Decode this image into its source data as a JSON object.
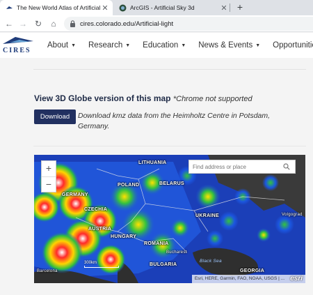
{
  "browser": {
    "tabs": [
      {
        "title": "The New World Atlas of Artificial",
        "active": true
      },
      {
        "title": "ArcGIS - Artificial Sky 3d",
        "active": false
      }
    ],
    "new_tab_label": "+",
    "url": "cires.colorado.edu/Artificial-light"
  },
  "site": {
    "logo_text": "CIRES",
    "nav": [
      {
        "label": "About"
      },
      {
        "label": "Research"
      },
      {
        "label": "Education"
      },
      {
        "label": "News & Events"
      },
      {
        "label": "Opportunities"
      }
    ]
  },
  "main": {
    "heading": "View 3D Globe version of this map",
    "heading_note": "*Chrome not supported",
    "download_button": "Download",
    "download_text": "Download kmz data from the Heimholtz Centre in Potsdam, Germany."
  },
  "map": {
    "zoom_in": "+",
    "zoom_out": "−",
    "search_placeholder": "Find address or place",
    "labels": {
      "lithuania": "LITHUANIA",
      "poland": "POLAND",
      "belarus": "BELARUS",
      "germany": "GERMANY",
      "czechia": "CZECHIA",
      "ukraine": "UKRAINE",
      "austria": "AUSTRIA",
      "hungary": "HUNGARY",
      "romania": "ROMANIA",
      "bulgaria": "BULGARIA",
      "georgia": "GEORGIA",
      "bucharest": "Bucharest",
      "black_sea": "Black Sea",
      "volgograd": "Volgograd",
      "barcelona": "Barcelona"
    },
    "scale_label": "300km",
    "attribution": "Esri, HERE, Garmin, FAO, NOAA, USGS | ...",
    "esri_logo": "esri"
  }
}
